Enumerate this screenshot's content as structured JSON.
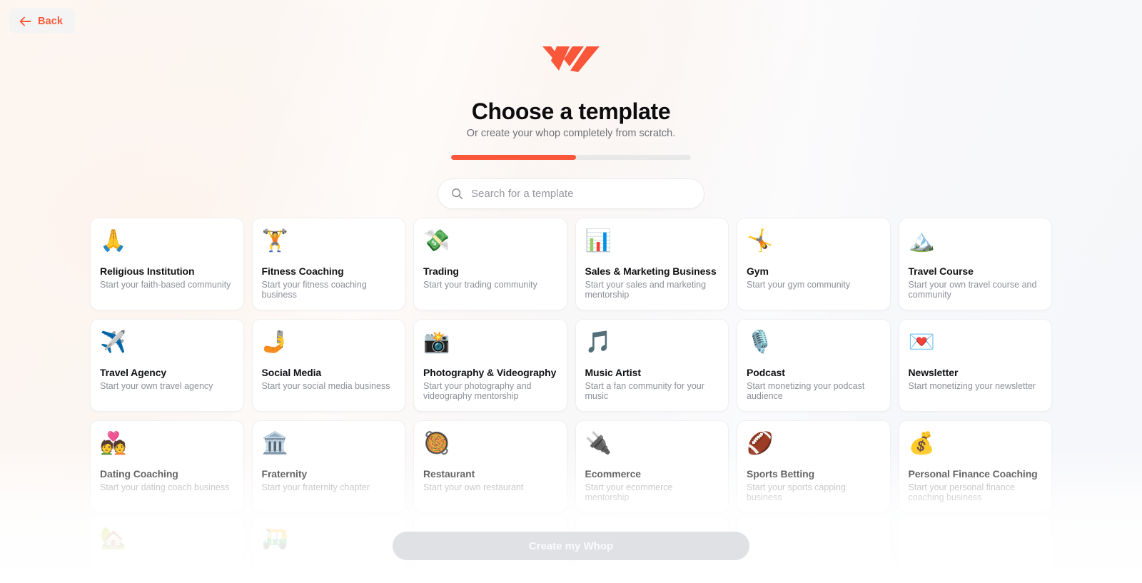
{
  "nav": {
    "back_label": "Back",
    "back_icon": "arrow-left-icon",
    "accent_color": "#fb5b3b"
  },
  "brand": {
    "logo_icon": "whop-logo",
    "logo_color": "#f9563a"
  },
  "header": {
    "title": "Choose a template",
    "subtitle": "Or create your whop completely from scratch.",
    "progress_percent": 52,
    "progress_fill_color": "#f9563a",
    "progress_track_color": "#e8e8e8"
  },
  "search": {
    "icon": "search-icon",
    "placeholder": "Search for a template",
    "value": ""
  },
  "templates": [
    {
      "emoji": "🙏",
      "icon_name": "folded-hands-emoji",
      "title": "Religious Institution",
      "desc": "Start your faith-based community"
    },
    {
      "emoji": "🏋️",
      "icon_name": "weightlifter-emoji",
      "title": "Fitness Coaching",
      "desc": "Start your fitness coaching business"
    },
    {
      "emoji": "💸",
      "icon_name": "money-with-wings-emoji",
      "title": "Trading",
      "desc": "Start your trading community"
    },
    {
      "emoji": "📊",
      "icon_name": "bar-chart-emoji",
      "title": "Sales & Marketing Business",
      "desc": "Start your sales and marketing mentorship"
    },
    {
      "emoji": "🤸",
      "icon_name": "cartwheel-emoji",
      "title": "Gym",
      "desc": "Start your gym community"
    },
    {
      "emoji": "🏔️",
      "icon_name": "mountain-emoji",
      "title": "Travel Course",
      "desc": "Start your own travel course and community"
    },
    {
      "emoji": "✈️",
      "icon_name": "airplane-emoji",
      "title": "Travel Agency",
      "desc": "Start your own travel agency"
    },
    {
      "emoji": "🤳",
      "icon_name": "selfie-emoji",
      "title": "Social Media",
      "desc": "Start your social media business"
    },
    {
      "emoji": "📸",
      "icon_name": "camera-flash-emoji",
      "title": "Photography & Videography",
      "desc": "Start your photography and videography mentorship"
    },
    {
      "emoji": "🎵",
      "icon_name": "musical-note-emoji",
      "title": "Music Artist",
      "desc": "Start a fan community for your music"
    },
    {
      "emoji": "🎙️",
      "icon_name": "microphone-emoji",
      "title": "Podcast",
      "desc": "Start monetizing your podcast audience"
    },
    {
      "emoji": "💌",
      "icon_name": "love-letter-emoji",
      "title": "Newsletter",
      "desc": "Start monetizing your newsletter"
    },
    {
      "emoji": "💑",
      "icon_name": "couple-with-heart-emoji",
      "title": "Dating Coaching",
      "desc": "Start your dating coach business"
    },
    {
      "emoji": "🏛️",
      "icon_name": "classical-building-emoji",
      "title": "Fraternity",
      "desc": "Start your fraternity chapter"
    },
    {
      "emoji": "🥘",
      "icon_name": "shallow-pan-of-food-emoji",
      "title": "Restaurant",
      "desc": "Start your own restaurant"
    },
    {
      "emoji": "🔌",
      "icon_name": "electric-plug-emoji",
      "title": "Ecommerce",
      "desc": "Start your ecommerce mentorship"
    },
    {
      "emoji": "🏈",
      "icon_name": "football-emoji",
      "title": "Sports Betting",
      "desc": "Start your sports capping business"
    },
    {
      "emoji": "💰",
      "icon_name": "money-bag-emoji",
      "title": "Personal Finance Coaching",
      "desc": "Start your personal finance coaching business"
    }
  ],
  "templates_partial": [
    {
      "emoji": "🏡",
      "icon_name": "house-with-garden-emoji"
    },
    {
      "emoji": "🛺",
      "icon_name": "auto-rickshaw-emoji"
    },
    {
      "emoji": "",
      "icon_name": "blank-emoji"
    },
    {
      "emoji": "",
      "icon_name": "blank-emoji"
    },
    {
      "emoji": "",
      "icon_name": "blank-emoji"
    },
    {
      "emoji": "",
      "icon_name": "blank-emoji"
    }
  ],
  "footer": {
    "cta_label": "Create my Whop",
    "cta_disabled": true
  }
}
